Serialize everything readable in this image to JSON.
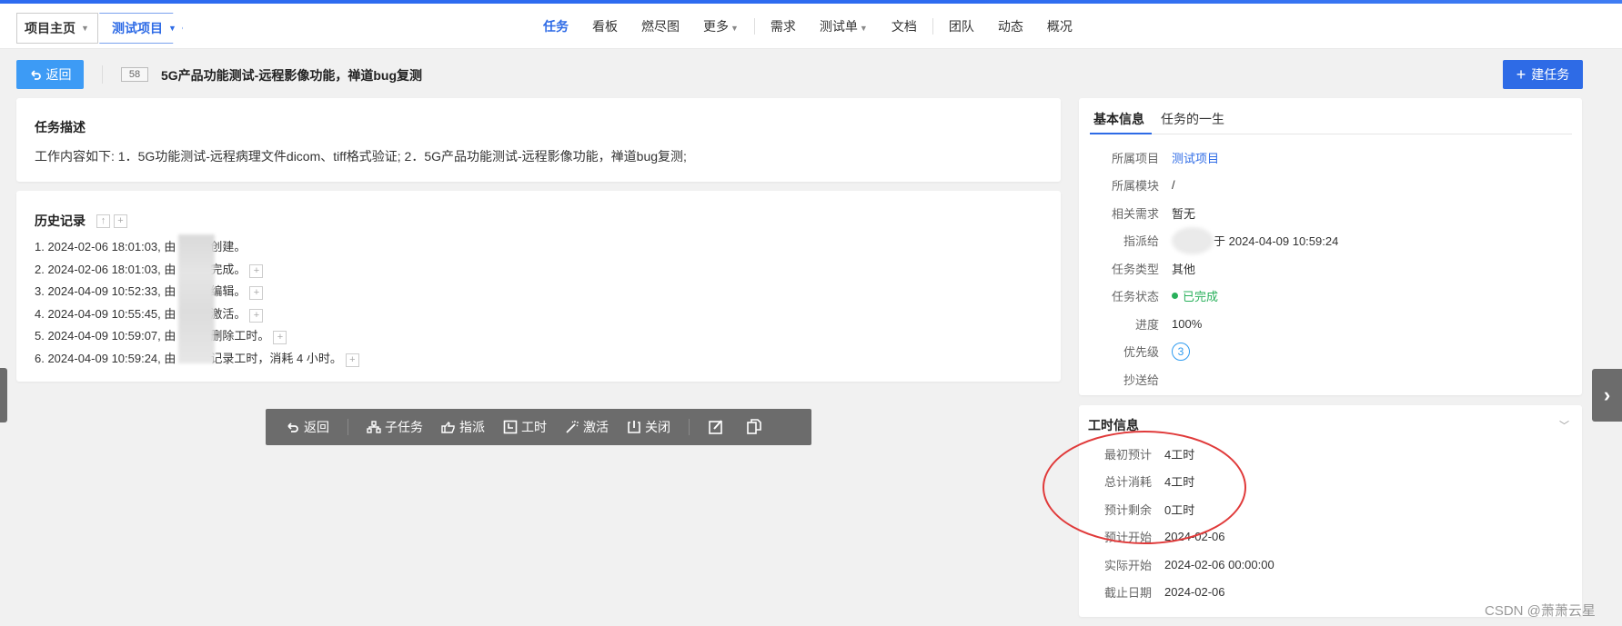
{
  "breadcrumb": {
    "home": "项目主页",
    "project": "测试项目"
  },
  "nav": {
    "items": [
      {
        "label": "任务",
        "active": true
      },
      {
        "label": "看板"
      },
      {
        "label": "燃尽图"
      },
      {
        "label": "更多",
        "dropdown": true
      },
      {
        "label": "需求"
      },
      {
        "label": "测试单",
        "dropdown": true
      },
      {
        "label": "文档"
      },
      {
        "label": "团队"
      },
      {
        "label": "动态"
      },
      {
        "label": "概况"
      }
    ]
  },
  "header": {
    "back_label": "返回",
    "task_id": "58",
    "task_title": "5G产品功能测试-远程影像功能，禅道bug复测",
    "new_task_label": "建任务"
  },
  "description": {
    "title": "任务描述",
    "text": "工作内容如下: 1．5G功能测试-远程病理文件dicom、tiff格式验证; 2．5G产品功能测试-远程影像功能，禅道bug复测;"
  },
  "history": {
    "title": "历史记录",
    "items": [
      {
        "prefix": "1. 2024-02-06 18:01:03, 由",
        "suffix": "创建。"
      },
      {
        "prefix": "2. 2024-02-06 18:01:03, 由",
        "suffix": "完成。"
      },
      {
        "prefix": "3. 2024-04-09 10:52:33, 由",
        "suffix": "编辑。"
      },
      {
        "prefix": "4. 2024-04-09 10:55:45, 由",
        "suffix": "激活。"
      },
      {
        "prefix": "5. 2024-04-09 10:59:07, 由",
        "suffix": "删除工时。"
      },
      {
        "prefix": "6. 2024-04-09 10:59:24, 由",
        "suffix": "记录工时，消耗 4 小时。"
      }
    ]
  },
  "toolbar": {
    "back": "返回",
    "subtask": "子任务",
    "assign": "指派",
    "worktime": "工时",
    "activate": "激活",
    "close": "关闭"
  },
  "basic_info": {
    "tab_basic": "基本信息",
    "tab_life": "任务的一生",
    "rows": {
      "project_label": "所属项目",
      "project_value": "测试项目",
      "module_label": "所属模块",
      "module_value": "/",
      "story_label": "相关需求",
      "story_value": "暂无",
      "assigned_label": "指派给",
      "assigned_value": "于 2024-04-09 10:59:24",
      "type_label": "任务类型",
      "type_value": "其他",
      "status_label": "任务状态",
      "status_value": "已完成",
      "progress_label": "进度",
      "progress_value": "100%",
      "priority_label": "优先级",
      "priority_value": "3",
      "cc_label": "抄送给",
      "cc_value": ""
    }
  },
  "time_info": {
    "title": "工时信息",
    "rows": {
      "estimate_label": "最初预计",
      "estimate_value": "4工时",
      "consumed_label": "总计消耗",
      "consumed_value": "4工时",
      "left_label": "预计剩余",
      "left_value": "0工时",
      "est_start_label": "预计开始",
      "est_start_value": "2024-02-06",
      "real_start_label": "实际开始",
      "real_start_value": "2024-02-06 00:00:00",
      "deadline_label": "截止日期",
      "deadline_value": "2024-02-06"
    }
  },
  "watermark": "CSDN @萧萧云星",
  "colors": {
    "primary": "#2e6be6",
    "back_button": "#3d9bf5",
    "done": "#29b05b",
    "annotation": "#e03a3a"
  }
}
